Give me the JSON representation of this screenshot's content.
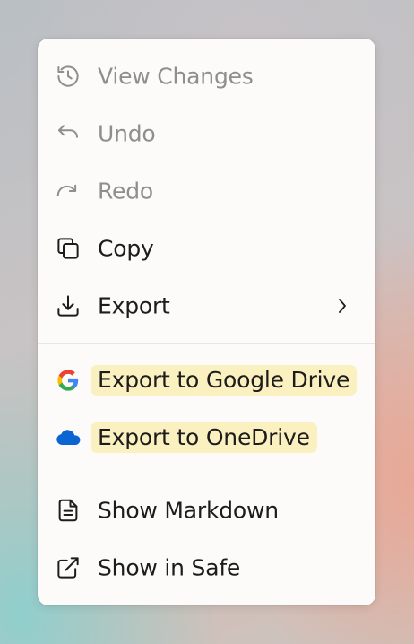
{
  "menu": {
    "items": [
      {
        "label": "View Changes",
        "icon": "history-icon",
        "disabled": true
      },
      {
        "label": "Undo",
        "icon": "undo-icon",
        "disabled": true
      },
      {
        "label": "Redo",
        "icon": "redo-icon",
        "disabled": true
      },
      {
        "label": "Copy",
        "icon": "copy-icon",
        "disabled": false
      },
      {
        "label": "Export",
        "icon": "download-icon",
        "disabled": false,
        "submenu_icon": "chevron-right-icon"
      },
      {
        "label": "Export to Google Drive",
        "icon": "google-drive-icon",
        "highlighted": true
      },
      {
        "label": "Export to OneDrive",
        "icon": "onedrive-icon",
        "highlighted": true
      },
      {
        "label": "Show Markdown",
        "icon": "document-icon",
        "disabled": false
      },
      {
        "label": "Show in Safe",
        "icon": "external-link-icon",
        "disabled": false
      }
    ]
  },
  "colors": {
    "menu_background": "#fcfbf9",
    "text": "#1c1c1c",
    "disabled_text": "#8e8e8e",
    "highlight": "#fbf0bf",
    "onedrive_blue": "#0a64d1"
  }
}
